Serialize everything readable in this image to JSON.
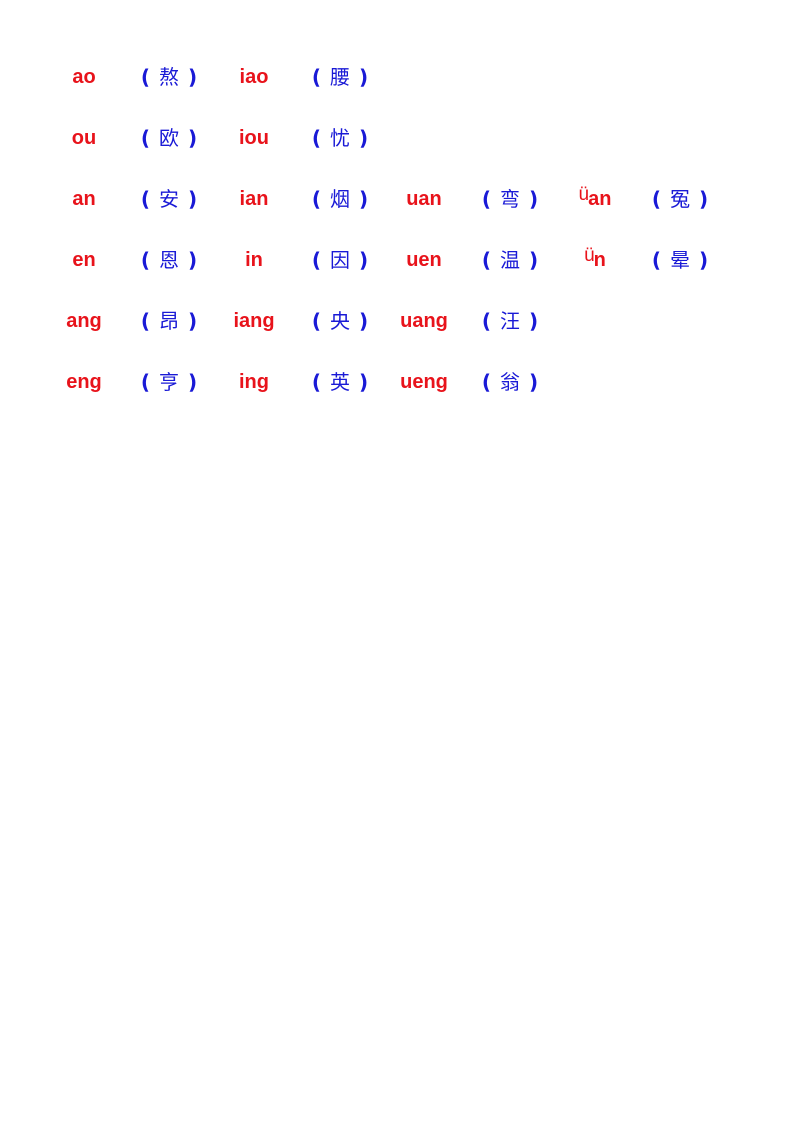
{
  "rows": [
    {
      "cells": [
        {
          "py": "ao",
          "hz": "熬"
        },
        {
          "py": "iao",
          "hz": "腰"
        }
      ]
    },
    {
      "cells": [
        {
          "py": "ou",
          "hz": "欧"
        },
        {
          "py": "iou",
          "hz": "忧"
        }
      ]
    },
    {
      "cells": [
        {
          "py": "an",
          "hz": "安"
        },
        {
          "py": "ian",
          "hz": "烟"
        },
        {
          "py": "uan",
          "hz": "弯"
        },
        {
          "u": "ü",
          "py": "an",
          "hz": "冤"
        }
      ]
    },
    {
      "cells": [
        {
          "py": "en",
          "hz": "恩"
        },
        {
          "py": "in",
          "hz": "因"
        },
        {
          "py": "uen",
          "hz": "温"
        },
        {
          "u": "ü",
          "py": "n",
          "hz": "晕"
        }
      ]
    },
    {
      "cells": [
        {
          "py": "ang",
          "hz": "昂"
        },
        {
          "py": "iang",
          "hz": "央"
        },
        {
          "py": "uang",
          "hz": "汪"
        }
      ]
    },
    {
      "cells": [
        {
          "py": "eng",
          "hz": "亨"
        },
        {
          "py": "ing",
          "hz": "英"
        },
        {
          "py": "ueng",
          "hz": "翁"
        }
      ]
    }
  ],
  "paren_open": "(",
  "paren_close": ")",
  "colors": {
    "pinyin": "#e8131b",
    "hanzi": "#1a1ad6"
  }
}
